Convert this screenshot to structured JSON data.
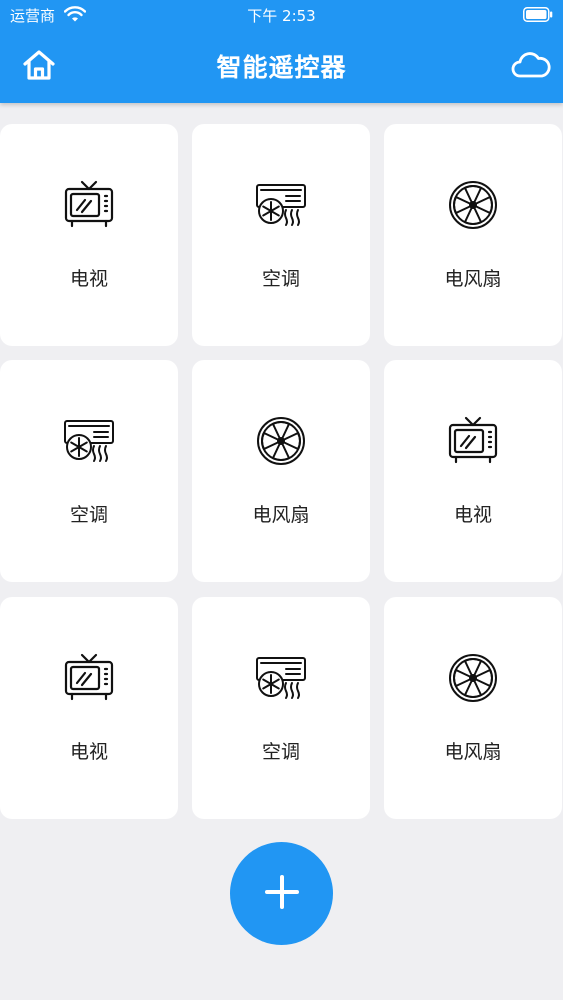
{
  "status_bar": {
    "carrier": "运营商",
    "time": "下午 2:53"
  },
  "nav": {
    "title": "智能遥控器",
    "left_icon": "home-icon",
    "right_icon": "cloud-icon"
  },
  "devices": [
    {
      "label": "电视",
      "icon": "tv-icon"
    },
    {
      "label": "空调",
      "icon": "air-conditioner-icon"
    },
    {
      "label": "电风扇",
      "icon": "fan-icon"
    },
    {
      "label": "空调",
      "icon": "air-conditioner-icon"
    },
    {
      "label": "电风扇",
      "icon": "fan-icon"
    },
    {
      "label": "电视",
      "icon": "tv-icon"
    },
    {
      "label": "电视",
      "icon": "tv-icon"
    },
    {
      "label": "空调",
      "icon": "air-conditioner-icon"
    },
    {
      "label": "电风扇",
      "icon": "fan-icon"
    }
  ],
  "add_button_icon": "plus-icon",
  "colors": {
    "primary": "#2196f3",
    "background": "#efeff2",
    "card": "#ffffff",
    "text": "#222222"
  }
}
